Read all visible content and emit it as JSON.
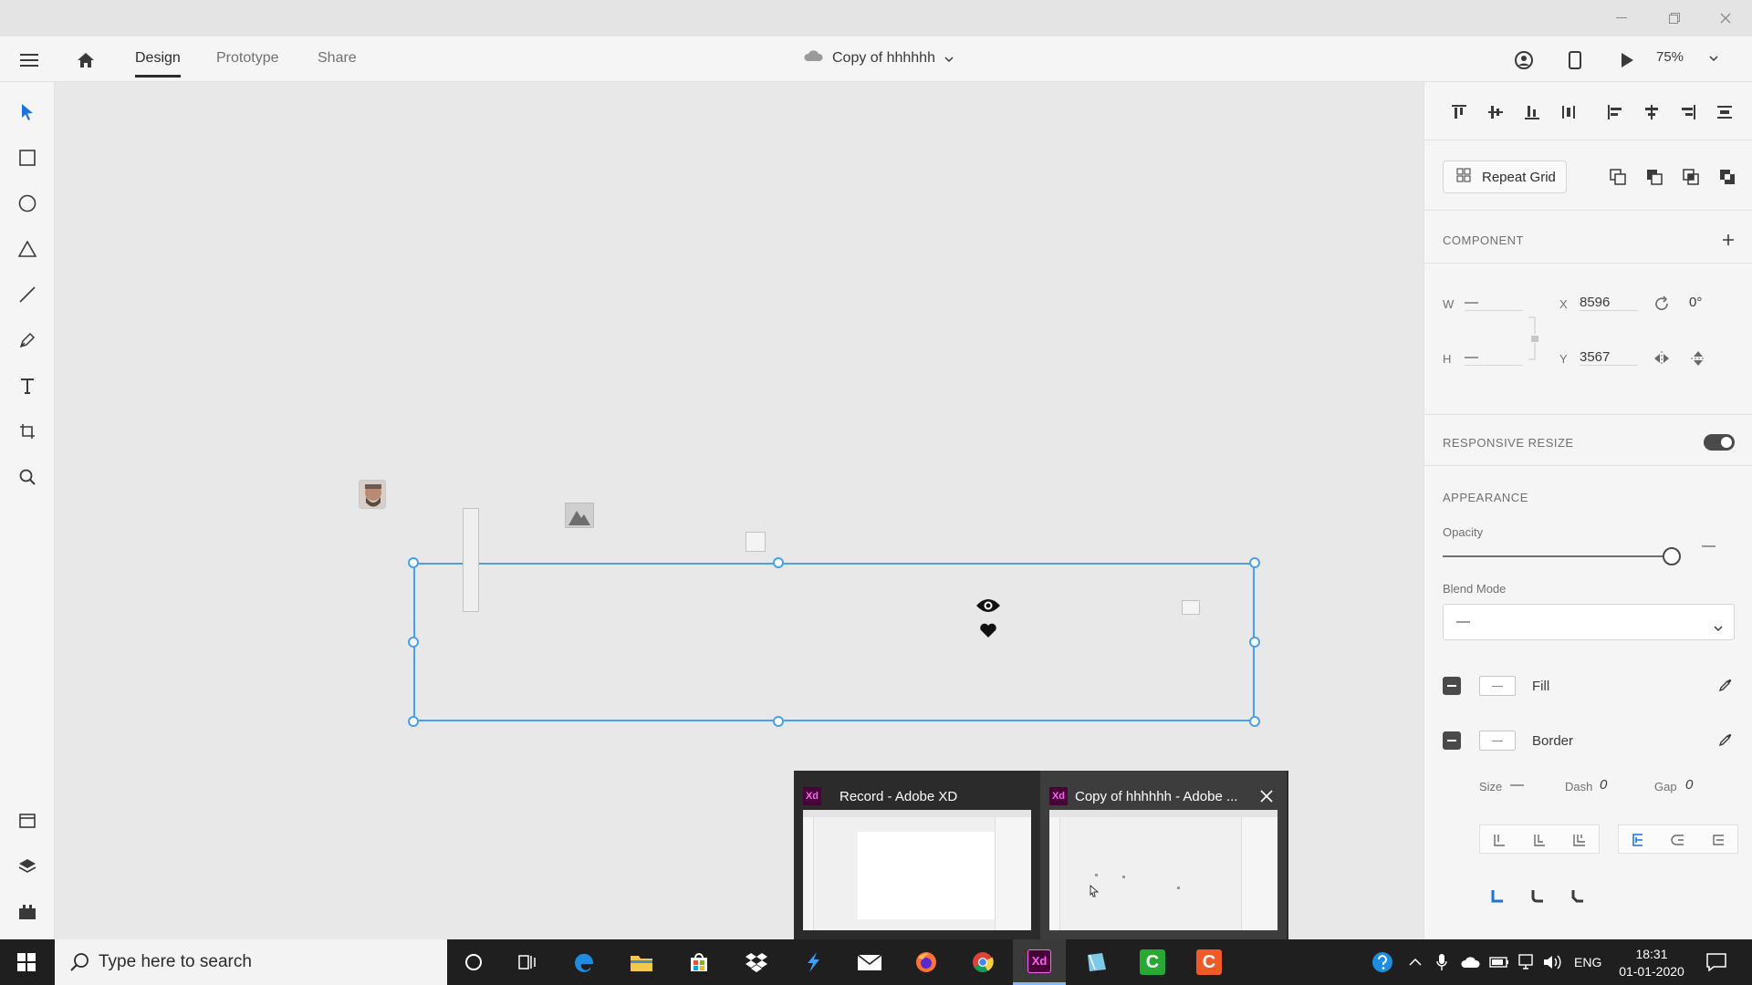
{
  "window": {
    "minimize_icon": "minimize-icon",
    "restore_icon": "restore-icon",
    "close_icon": "close-icon"
  },
  "appbar": {
    "tabs": [
      {
        "label": "Design",
        "active": true
      },
      {
        "label": "Prototype",
        "active": false
      },
      {
        "label": "Share",
        "active": false
      }
    ],
    "document_title": "Copy of hhhhhh",
    "zoom": "75%"
  },
  "panel": {
    "repeat_grid_label": "Repeat Grid",
    "component_label": "COMPONENT",
    "w_label": "W",
    "h_label": "H",
    "w_value": "—",
    "h_value": "—",
    "x_label": "X",
    "y_label": "Y",
    "x_value": "8596",
    "y_value": "3567",
    "rotation_value": "0°",
    "responsive_resize_label": "RESPONSIVE RESIZE",
    "responsive_resize_on": true,
    "appearance_label": "APPEARANCE",
    "opacity_label": "Opacity",
    "opacity_value": "—",
    "blend_mode_label": "Blend Mode",
    "blend_mode_value": "—",
    "fill_label": "Fill",
    "border_label": "Border",
    "size_label": "Size",
    "size_value": "—",
    "dash_label": "Dash",
    "dash_value": "0",
    "gap_label": "Gap",
    "gap_value": "0"
  },
  "task_previews": [
    {
      "title": "Record - Adobe XD",
      "badge": "Xd"
    },
    {
      "title": "Copy of hhhhhh - Adobe ...",
      "badge": "Xd"
    }
  ],
  "taskbar": {
    "search_placeholder": "Type here to search",
    "language": "ENG",
    "time": "18:31",
    "date": "01-01-2020"
  },
  "colors": {
    "accent": "#4a9fe8",
    "taskbar": "#1f1f1f",
    "xd_badge": "#470137"
  }
}
